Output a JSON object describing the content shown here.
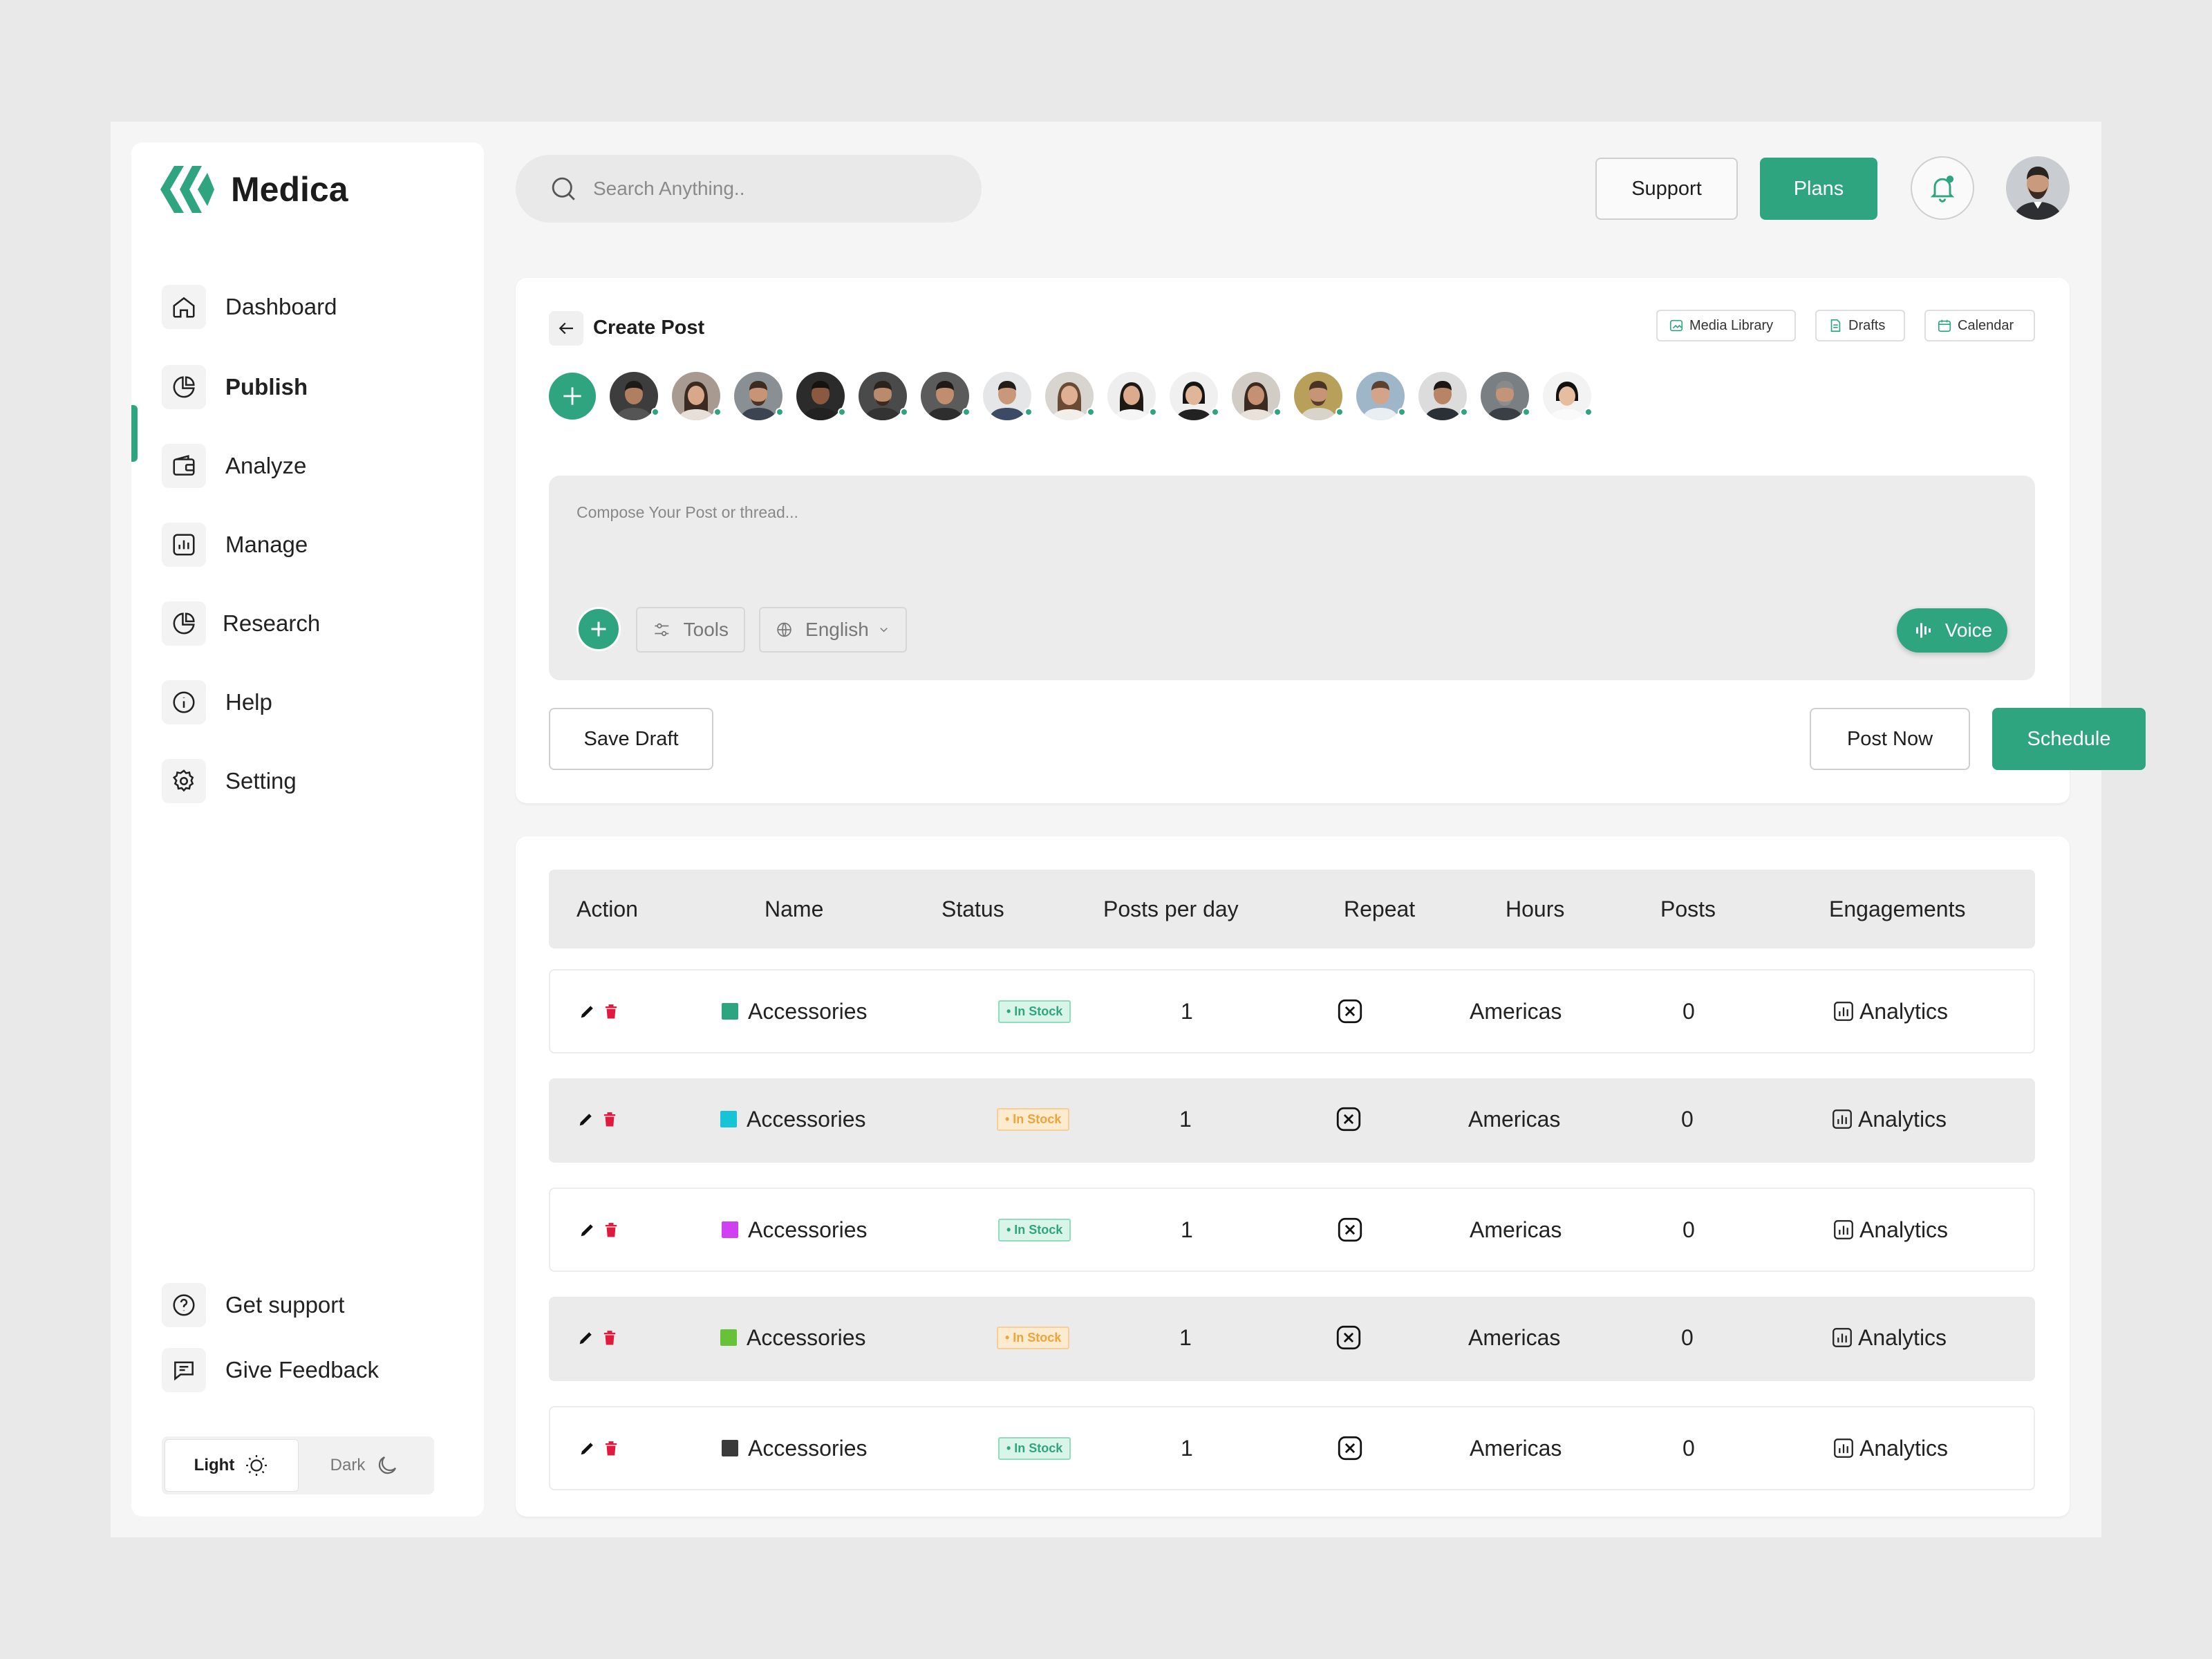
{
  "brand": {
    "name": "Medica",
    "accent": "#2fa57f"
  },
  "sidebar": {
    "items": [
      {
        "label": "Dashboard",
        "icon": "home-icon"
      },
      {
        "label": "Publish",
        "icon": "pie-chart-icon",
        "active": true
      },
      {
        "label": "Analyze",
        "icon": "wallet-icon"
      },
      {
        "label": "Manage",
        "icon": "bar-chart-icon"
      },
      {
        "label": "Research",
        "icon": "pie-chart-icon"
      },
      {
        "label": "Help",
        "icon": "info-icon"
      },
      {
        "label": "Setting",
        "icon": "gear-icon"
      }
    ],
    "footer": [
      {
        "label": "Get support",
        "icon": "question-icon"
      },
      {
        "label": "Give Feedback",
        "icon": "chat-icon"
      }
    ],
    "theme": {
      "light": "Light",
      "dark": "Dark",
      "selected": "Light"
    }
  },
  "topbar": {
    "search_placeholder": "Search Anything..",
    "support_label": "Support",
    "plans_label": "Plans"
  },
  "create_post": {
    "title": "Create Post",
    "chips": {
      "media_library": "Media Library",
      "drafts": "Drafts",
      "calendar": "Calendar"
    },
    "composer_placeholder": "Compose Your Post  or thread...",
    "tools_label": "Tools",
    "language": "English",
    "voice_label": "Voice",
    "save_draft": "Save Draft",
    "post_now": "Post  Now",
    "schedule": "Schedule"
  },
  "table": {
    "headers": [
      "Action",
      "Name",
      "Status",
      "Posts per day",
      "Repeat",
      "Hours",
      "Posts",
      "Engagements"
    ],
    "rows": [
      {
        "name": "Accessories",
        "color": "#2fa57f",
        "status": "In Stock",
        "status_tone": "green",
        "posts_per_day": "1",
        "hours": "Americas",
        "posts": "0",
        "engagement": "Analytics"
      },
      {
        "name": "Accessories",
        "color": "#17c3d6",
        "status": "In Stock",
        "status_tone": "orange",
        "posts_per_day": "1",
        "hours": "Americas",
        "posts": "0",
        "engagement": "Analytics"
      },
      {
        "name": "Accessories",
        "color": "#d040f0",
        "status": "In Stock",
        "status_tone": "green",
        "posts_per_day": "1",
        "hours": "Americas",
        "posts": "0",
        "engagement": "Analytics"
      },
      {
        "name": "Accessories",
        "color": "#67c23a",
        "status": "In Stock",
        "status_tone": "orange",
        "posts_per_day": "1",
        "hours": "Americas",
        "posts": "0",
        "engagement": "Analytics"
      },
      {
        "name": "Accessories",
        "color": "#3a3a3a",
        "status": "In Stock",
        "status_tone": "green",
        "posts_per_day": "1",
        "hours": "Americas",
        "posts": "0",
        "engagement": "Analytics"
      }
    ]
  }
}
